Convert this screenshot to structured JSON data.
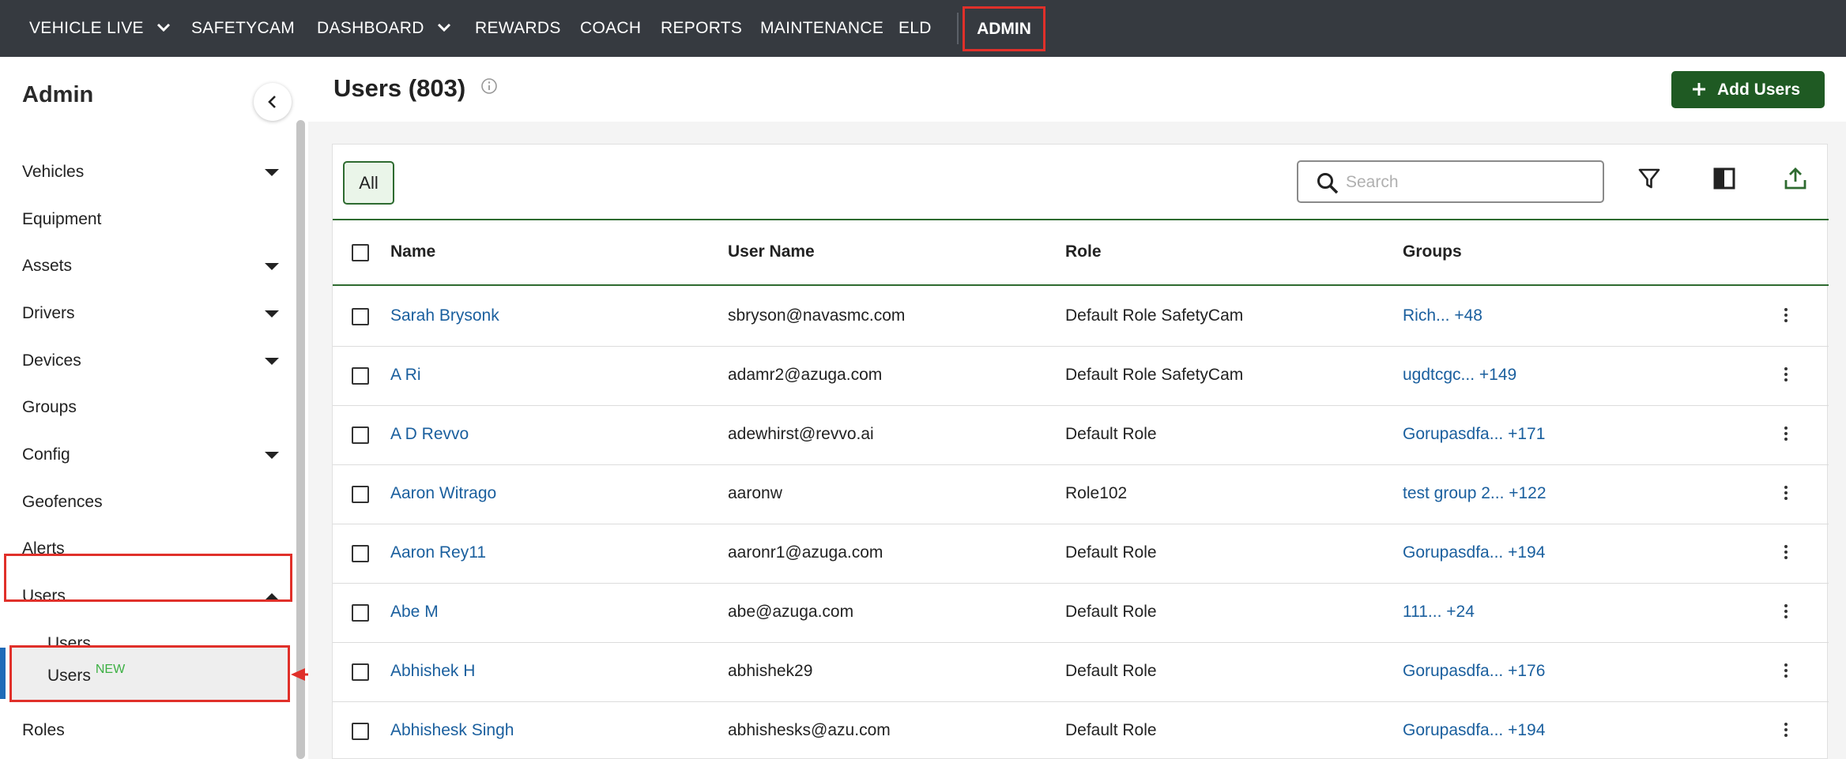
{
  "nav": {
    "items": [
      {
        "label": "VEHICLE LIVE",
        "dropdown": true
      },
      {
        "label": "SAFETYCAM",
        "dropdown": false
      },
      {
        "label": "DASHBOARD",
        "dropdown": true
      },
      {
        "label": "REWARDS",
        "dropdown": false
      },
      {
        "label": "COACH",
        "dropdown": false
      },
      {
        "label": "REPORTS",
        "dropdown": false
      },
      {
        "label": "MAINTENANCE",
        "dropdown": false
      },
      {
        "label": "ELD",
        "dropdown": false
      }
    ],
    "admin_label": "ADMIN"
  },
  "sidebar": {
    "title": "Admin",
    "items": [
      {
        "label": "Vehicles",
        "caret": "down"
      },
      {
        "label": "Equipment"
      },
      {
        "label": "Assets",
        "caret": "down"
      },
      {
        "label": "Drivers",
        "caret": "down"
      },
      {
        "label": "Devices",
        "caret": "down"
      },
      {
        "label": "Groups"
      },
      {
        "label": "Config",
        "caret": "down"
      },
      {
        "label": "Geofences"
      },
      {
        "label": "Alerts"
      },
      {
        "label": "Users",
        "caret": "up"
      }
    ],
    "sub_items": [
      {
        "label": "Users"
      },
      {
        "label": "Users",
        "badge": "NEW",
        "active": true
      }
    ],
    "after_items": [
      {
        "label": "Roles"
      }
    ]
  },
  "header": {
    "title": "Users (803)",
    "add_button_label": "Add Users"
  },
  "toolbar": {
    "filter_chip": "All",
    "search_placeholder": "Search"
  },
  "table": {
    "columns": [
      "Name",
      "User Name",
      "Role",
      "Groups"
    ],
    "rows": [
      {
        "name": "Sarah Brysonk",
        "username": "sbryson@navasmc.com",
        "role": "Default Role SafetyCam",
        "groups": "Rich... +48"
      },
      {
        "name": "A Ri",
        "username": "adamr2@azuga.com",
        "role": "Default Role SafetyCam",
        "groups": "ugdtcgc... +149"
      },
      {
        "name": "A D Revvo",
        "username": "adewhirst@revvo.ai",
        "role": "Default Role",
        "groups": "Gorupasdfa... +171"
      },
      {
        "name": "Aaron Witrago",
        "username": "aaronw",
        "role": "Role102",
        "groups": "test group 2... +122"
      },
      {
        "name": "Aaron Rey11",
        "username": "aaronr1@azuga.com",
        "role": "Default Role",
        "groups": "Gorupasdfa... +194"
      },
      {
        "name": "Abe M",
        "username": "abe@azuga.com",
        "role": "Default Role",
        "groups": "111... +24"
      },
      {
        "name": "Abhishek H",
        "username": "abhishek29",
        "role": "Default Role",
        "groups": "Gorupasdfa... +176"
      },
      {
        "name": "Abhishesk Singh",
        "username": "abhishesks@azu.com",
        "role": "Default Role",
        "groups": "Gorupasdfa... +194"
      }
    ]
  },
  "colors": {
    "nav_bg": "#363a40",
    "accent_green": "#1f5a23",
    "link_blue": "#1a5f9e",
    "highlight_red": "#e0302a",
    "badge_green": "#3cb043"
  }
}
